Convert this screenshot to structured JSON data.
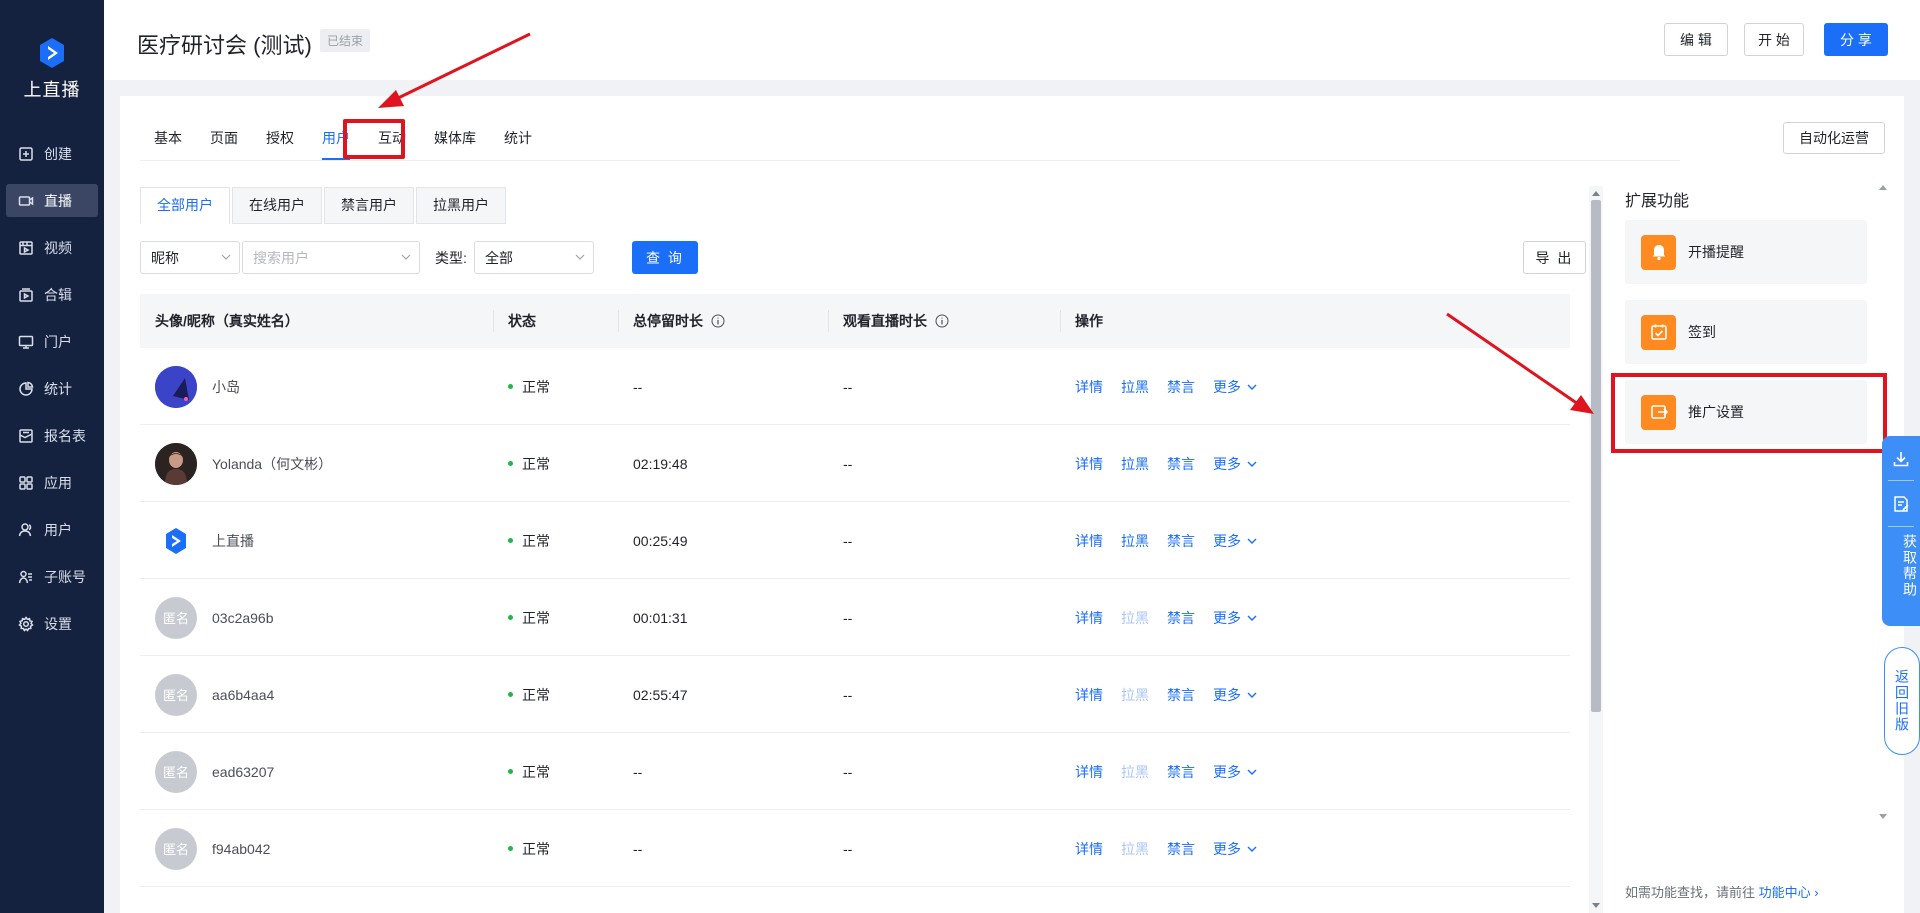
{
  "app": {
    "logo_text": "上直播"
  },
  "sidebar": {
    "items": [
      {
        "label": "创建",
        "icon": "plus-square-icon"
      },
      {
        "label": "直播",
        "icon": "video-camera-icon",
        "active": true
      },
      {
        "label": "视频",
        "icon": "film-icon"
      },
      {
        "label": "合辑",
        "icon": "collection-icon"
      },
      {
        "label": "门户",
        "icon": "monitor-icon"
      },
      {
        "label": "统计",
        "icon": "pie-chart-icon"
      },
      {
        "label": "报名表",
        "icon": "form-icon"
      },
      {
        "label": "应用",
        "icon": "apps-icon"
      },
      {
        "label": "用户",
        "icon": "user-icon"
      },
      {
        "label": "子账号",
        "icon": "sub-account-icon"
      },
      {
        "label": "设置",
        "icon": "gear-icon"
      }
    ]
  },
  "header": {
    "title": "医疗研讨会 (测试)",
    "status_badge": "已结束",
    "edit_label": "编 辑",
    "start_label": "开 始",
    "share_label": "分 享"
  },
  "tabs": {
    "items": [
      "基本",
      "页面",
      "授权",
      "用户",
      "互动",
      "媒体库",
      "统计"
    ],
    "active": "用户",
    "automation_label": "自动化运营"
  },
  "subtabs": {
    "items": [
      "全部用户",
      "在线用户",
      "禁言用户",
      "拉黑用户"
    ],
    "active": "全部用户"
  },
  "filters": {
    "field_select": "昵称",
    "search_placeholder": "搜索用户",
    "type_label": "类型:",
    "type_select": "全部",
    "query_label": "查 询",
    "export_label": "导 出"
  },
  "table": {
    "headers": [
      "头像/昵称（真实姓名）",
      "状态",
      "总停留时长",
      "观看直播时长",
      "操作"
    ],
    "actions": {
      "detail": "详情",
      "block": "拉黑",
      "mute": "禁言",
      "more": "更多"
    },
    "rows": [
      {
        "avatar": "",
        "avatar_style": "blue",
        "nickname": "小岛",
        "status": "正常",
        "stay": "--",
        "watch": "--",
        "block_enabled": true
      },
      {
        "avatar": "",
        "avatar_style": "photo",
        "nickname": "Yolanda（何文彬）",
        "status": "正常",
        "stay": "02:19:48",
        "watch": "--",
        "block_enabled": true
      },
      {
        "avatar": "",
        "avatar_style": "brand",
        "nickname": "上直播",
        "status": "正常",
        "stay": "00:25:49",
        "watch": "--",
        "block_enabled": true
      },
      {
        "avatar": "匿名",
        "avatar_style": "anon",
        "nickname": "03c2a96b",
        "status": "正常",
        "stay": "00:01:31",
        "watch": "--",
        "block_enabled": false
      },
      {
        "avatar": "匿名",
        "avatar_style": "anon",
        "nickname": "aa6b4aa4",
        "status": "正常",
        "stay": "02:55:47",
        "watch": "--",
        "block_enabled": false
      },
      {
        "avatar": "匿名",
        "avatar_style": "anon",
        "nickname": "ead63207",
        "status": "正常",
        "stay": "--",
        "watch": "--",
        "block_enabled": false
      },
      {
        "avatar": "匿名",
        "avatar_style": "anon",
        "nickname": "f94ab042",
        "status": "正常",
        "stay": "--",
        "watch": "--",
        "block_enabled": false
      }
    ]
  },
  "extensions": {
    "title": "扩展功能",
    "items": [
      {
        "label": "开播提醒",
        "icon": "bell-icon"
      },
      {
        "label": "签到",
        "icon": "calendar-check-icon"
      },
      {
        "label": "推广设置",
        "icon": "share-screen-icon"
      }
    ],
    "footer_text": "如需功能查找，请前往",
    "footer_link": "功能中心 ›"
  },
  "floating": {
    "help_label": "获取帮助",
    "old_version_label": "返回旧版"
  },
  "colors": {
    "primary": "#1a6ef7",
    "sidebar_bg": "#15223f",
    "annotation_red": "#e0141e",
    "orange": "#ff8a1f"
  }
}
